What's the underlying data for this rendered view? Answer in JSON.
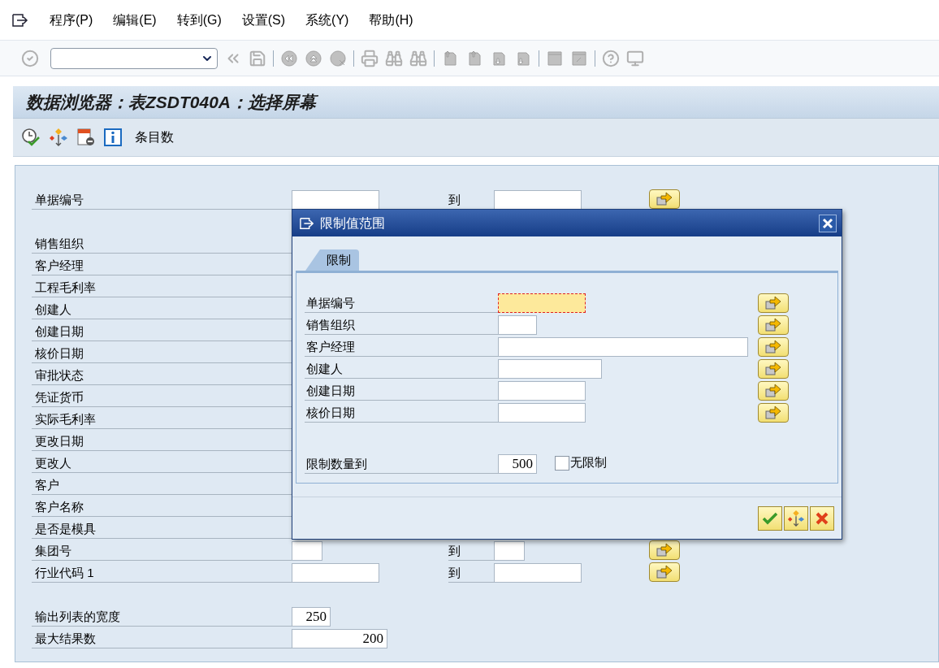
{
  "menu": [
    {
      "label": "程序(P)"
    },
    {
      "label": "编辑(E)"
    },
    {
      "label": "转到(G)"
    },
    {
      "label": "设置(S)"
    },
    {
      "label": "系统(Y)"
    },
    {
      "label": "帮助(H)"
    }
  ],
  "title": "数据浏览器：表ZSDT040A：选择屏幕",
  "app_toolbar": {
    "entries_button": "条目数"
  },
  "selection": {
    "groups": [
      {
        "rows": [
          {
            "label": "单据编号",
            "kind": "range",
            "to": "到"
          }
        ]
      },
      {
        "rows": [
          {
            "label": "销售组织",
            "kind": "label"
          },
          {
            "label": "客户经理",
            "kind": "label"
          },
          {
            "label": "工程毛利率",
            "kind": "label"
          },
          {
            "label": "创建人",
            "kind": "label"
          },
          {
            "label": "创建日期",
            "kind": "label"
          },
          {
            "label": "核价日期",
            "kind": "label"
          },
          {
            "label": "审批状态",
            "kind": "label"
          },
          {
            "label": "凭证货币",
            "kind": "label"
          },
          {
            "label": "实际毛利率",
            "kind": "label"
          },
          {
            "label": "更改日期",
            "kind": "label"
          },
          {
            "label": "更改人",
            "kind": "label"
          },
          {
            "label": "客户",
            "kind": "label"
          },
          {
            "label": "客户名称",
            "kind": "label"
          },
          {
            "label": "是否是模具",
            "kind": "label"
          },
          {
            "label": "集团号",
            "kind": "range_narrow",
            "to": "到"
          },
          {
            "label": "行业代码 1",
            "kind": "range",
            "to": "到"
          }
        ]
      }
    ],
    "settings": [
      {
        "label": "输出列表的宽度",
        "value": "250",
        "kind": "short"
      },
      {
        "label": "最大结果数",
        "value": "200",
        "kind": "long"
      }
    ]
  },
  "dialog": {
    "title": "限制值范围",
    "tabs": [
      {
        "label": "限制",
        "selected": true
      }
    ],
    "rows": [
      {
        "label": "单据编号",
        "kind": "medium",
        "focused": true
      },
      {
        "label": "销售组织",
        "kind": "short",
        "focused": false
      },
      {
        "label": "客户经理",
        "kind": "xlong",
        "focused": false
      },
      {
        "label": "创建人",
        "kind": "long",
        "focused": false
      },
      {
        "label": "创建日期",
        "kind": "medium",
        "focused": false
      },
      {
        "label": "核价日期",
        "kind": "medium",
        "focused": false
      }
    ],
    "limit": {
      "label": "限制数量到",
      "value": "500"
    },
    "no_limit": {
      "label": "无限制",
      "checked": false
    }
  }
}
